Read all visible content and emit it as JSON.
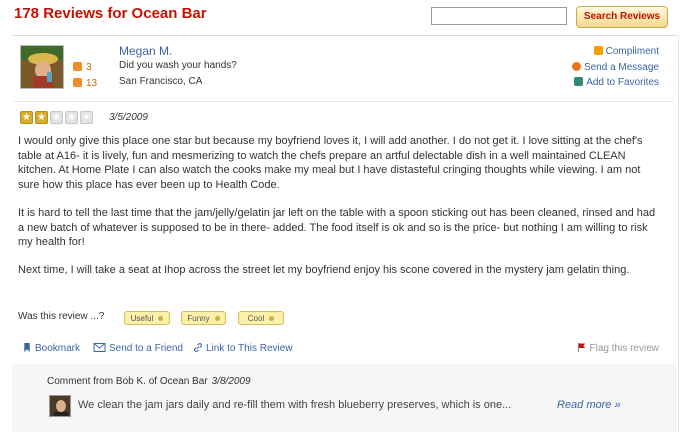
{
  "header": {
    "title": "178 Reviews for Ocean Bar",
    "search_placeholder": "",
    "search_button_label": "Search Reviews"
  },
  "reviewer": {
    "name": "Megan M.",
    "tagline": "Did you wash your hands?",
    "location": "San Francisco, CA",
    "friends_count": "3",
    "reviews_count": "13"
  },
  "side_actions": {
    "compliment": "Compliment",
    "send_message": "Send a Message",
    "add_favorites": "Add to Favorites"
  },
  "review": {
    "rating": 2,
    "rating_max": 5,
    "date": "3/5/2009",
    "paragraphs": [
      "I would only give this place one star but because my boyfriend loves it, I will add another. I do not get it. I love sitting at the chef's table at A16- it is lively, fun and mesmerizing to watch the chefs prepare an artful delectable dish in a well maintained CLEAN kitchen. At Home Plate I can also watch the cooks make my meal but I have distasteful cringing thoughts while viewing. I am not sure how this place has ever been up to Health Code.",
      "It is hard to tell the last time that the jam/jelly/gelatin jar left on the table with a spoon sticking out has been cleaned, rinsed and had a new batch of whatever is supposed to be in there- added. The food itself is ok and so is the price- but nothing I am willing to risk my health for!",
      "Next time, I will take a seat at Ihop across the street let my boyfriend enjoy his scone covered in the mystery jam gelatin thing."
    ]
  },
  "voting": {
    "question": "Was this review ...?",
    "useful": "Useful",
    "funny": "Funny",
    "cool": "Cool"
  },
  "review_actions": {
    "bookmark": "Bookmark",
    "send_friend": "Send to a Friend",
    "link": "Link to This Review",
    "flag": "Flag this review"
  },
  "owner_comment": {
    "heading": "Comment from Bob K. of Ocean Bar",
    "date": "3/8/2009",
    "text": "We clean the jam jars daily and re-fill them with fresh blueberry preserves, which is one...",
    "read_more": "Read more »"
  },
  "colors": {
    "brand_red": "#c41200",
    "link_blue": "#3b65a7",
    "star_gold": "#d8ad2e"
  }
}
